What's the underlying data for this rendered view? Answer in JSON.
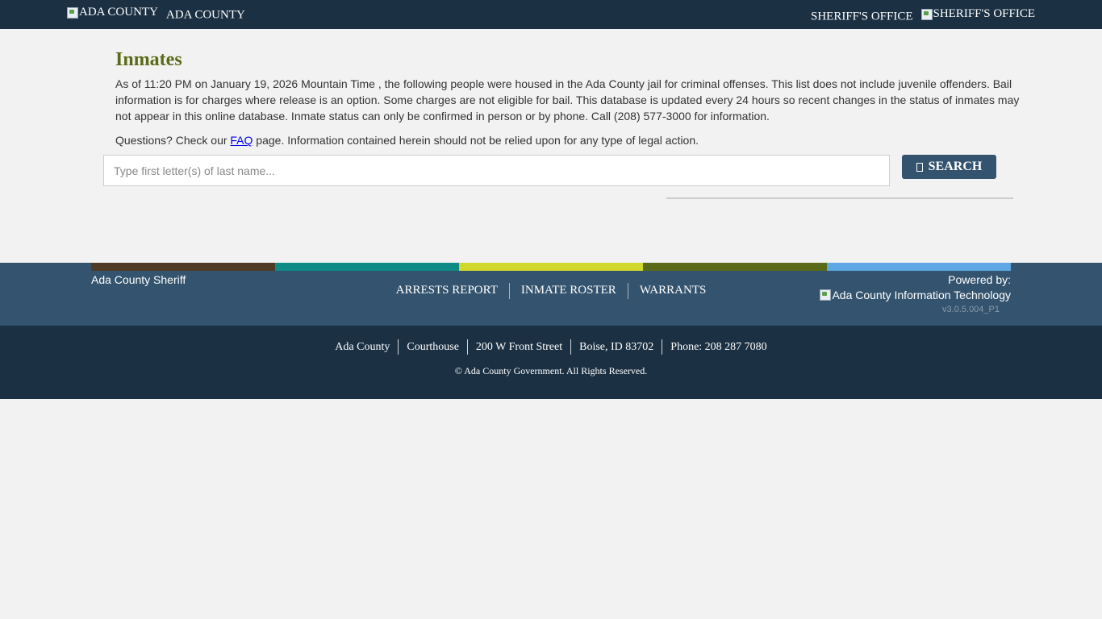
{
  "header": {
    "left_logo_alt": "ADA COUNTY",
    "left_title": "ADA COUNTY",
    "right_title": "SHERIFF'S OFFICE",
    "right_logo_alt": "SHERIFF'S OFFICE"
  },
  "main": {
    "title": "Inmates",
    "intro": "As of 11:20 PM on January 19, 2026 Mountain Time , the following people were housed in the Ada County jail for criminal offenses. This list does not include juvenile offenders. Bail information is for charges where release is an option. Some charges are not eligible for bail. This database is updated every 24 hours so recent changes in the status of inmates may not appear in this online database. Inmate status can only be confirmed in person or by phone. Call (208) 577-3000 for information.",
    "questions_prefix": "Questions? Check our ",
    "faq_link": "FAQ",
    "questions_suffix": " page. Information contained herein should not be relied upon for any type of legal action."
  },
  "search": {
    "placeholder": "Type first letter(s) of last name...",
    "value": "",
    "button_label": "SEARCH"
  },
  "footer": {
    "stripe_colors": [
      "#4f3a26",
      "#0e8a87",
      "#d1d72c",
      "#5b6a18",
      "#5da8e4"
    ],
    "org_name": "Ada County Sheriff",
    "nav": [
      "ARRESTS REPORT",
      "INMATE ROSTER",
      "WARRANTS"
    ],
    "powered_by": "Powered by:",
    "powered_logo_alt": "Ada County Information Technology",
    "version": "v3.0.5.004_P1"
  },
  "bottom": {
    "address": [
      "Ada County",
      "Courthouse",
      "200 W Front Street",
      "Boise, ID 83702",
      "Phone: 208 287 7080"
    ],
    "copyright": "© Ada County Government. All Rights Reserved."
  }
}
